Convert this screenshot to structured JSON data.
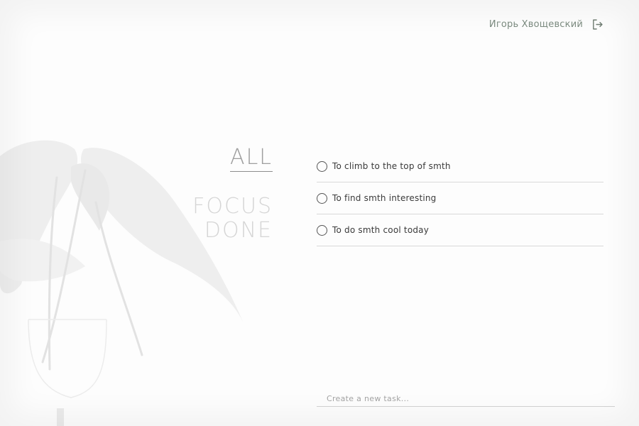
{
  "header": {
    "user_name": "Игорь Хвощевский",
    "logout_icon": "logout-icon"
  },
  "filters": {
    "items": [
      {
        "label": "ALL",
        "active": true
      },
      {
        "label": "FOCUS",
        "active": false
      },
      {
        "label": "DONE",
        "active": false
      }
    ]
  },
  "tasks": [
    {
      "text": "To climb to the top of smth",
      "done": false
    },
    {
      "text": "To find smth interesting",
      "done": false
    },
    {
      "text": "To do smth cool today",
      "done": false
    }
  ],
  "new_task": {
    "placeholder": "Create a new task...",
    "value": ""
  },
  "background": {
    "image": "plant-leaves-illustration"
  },
  "colors": {
    "username": "#7b8a7f",
    "active_filter": "#9e9e9e",
    "inactive_filter": "#d5d5d5"
  }
}
